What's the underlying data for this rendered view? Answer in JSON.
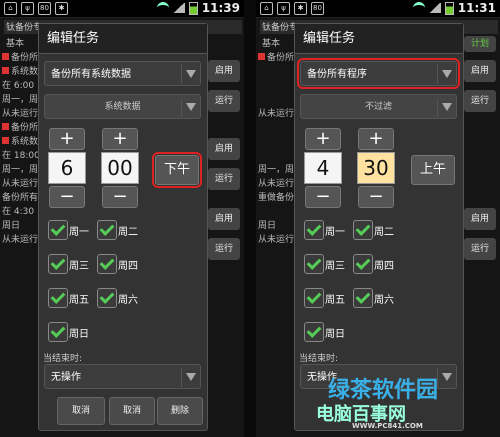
{
  "status": {
    "time_left": "11:39",
    "time_right": "11:31",
    "icons": [
      "sim-icon",
      "usb-icon",
      "debug-icon",
      "battery-80-icon",
      "wifi-icon",
      "signal-icon",
      "battery-icon"
    ],
    "badge": "80"
  },
  "left": {
    "app_title": "钛备份专",
    "bg_lines": [
      "基本",
      "备份所有",
      "系统数据",
      "在 6:00",
      "周一，周二",
      "从未运行",
      "备份所有",
      "系统数据",
      "在 18:00",
      "周一，周二",
      "从未运行",
      "备份所有",
      "在 4:30",
      "周日",
      "从未运行"
    ],
    "bg_buttons": [
      "启用",
      "运行",
      "启用",
      "运行",
      "启用",
      "运行"
    ],
    "dialog_title": "编辑任务",
    "spinner1": "备份所有系统数据",
    "spinner2": "系统数据",
    "hour": "6",
    "minute": "00",
    "ampm": "下午",
    "days": [
      "周一",
      "周二",
      "周三",
      "周四",
      "周五",
      "周六",
      "周日"
    ],
    "when_done_label": "当结束时:",
    "when_done_value": "无操作",
    "buttons": [
      "取消",
      "取消",
      "删除"
    ]
  },
  "right": {
    "app_title": "钛备份专",
    "bg_lines": [
      "基本",
      "备份所有",
      "从未运行",
      "周一，周二",
      "从未运行",
      "重做备份",
      "周日",
      "从未运行"
    ],
    "bg_buttons": [
      "计划",
      "启用",
      "运行",
      "启用",
      "运行"
    ],
    "dialog_title": "编辑任务",
    "spinner1": "备份所有程序",
    "spinner2": "不过滤",
    "hour": "4",
    "minute": "30",
    "ampm": "上午",
    "days": [
      "周一",
      "周二",
      "周三",
      "周四",
      "周五",
      "周六",
      "周日"
    ],
    "when_done_label": "当结束时:",
    "when_done_value": "无操作"
  },
  "plus": "+",
  "minus": "−",
  "watermark1": "绿茶软件园",
  "watermark2": "电脑百事网",
  "watermark3": "WWW.PC841.COM"
}
